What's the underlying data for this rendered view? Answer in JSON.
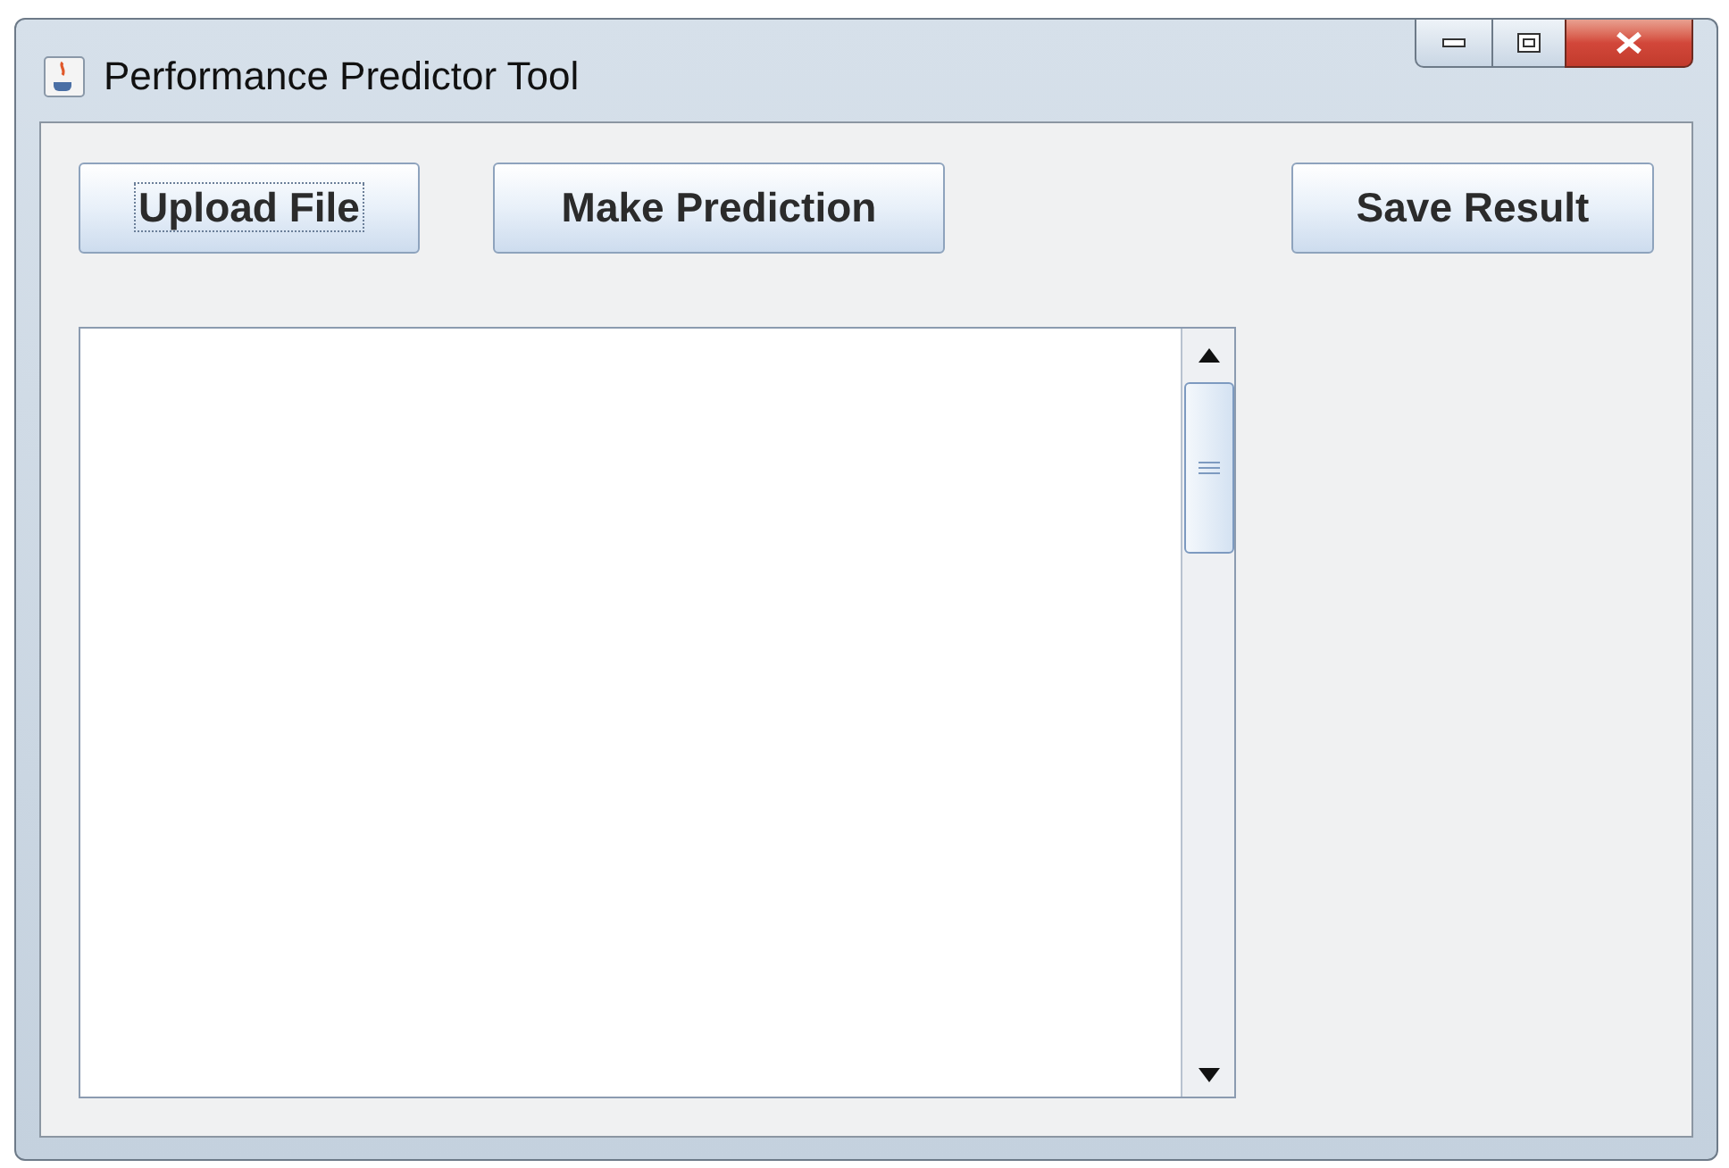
{
  "window": {
    "title": "Performance Predictor Tool"
  },
  "buttons": [
    {
      "label": "Upload File",
      "focused": true
    },
    {
      "label": "Make Prediction",
      "focused": false
    },
    {
      "label": "Save Result",
      "focused": false
    }
  ]
}
